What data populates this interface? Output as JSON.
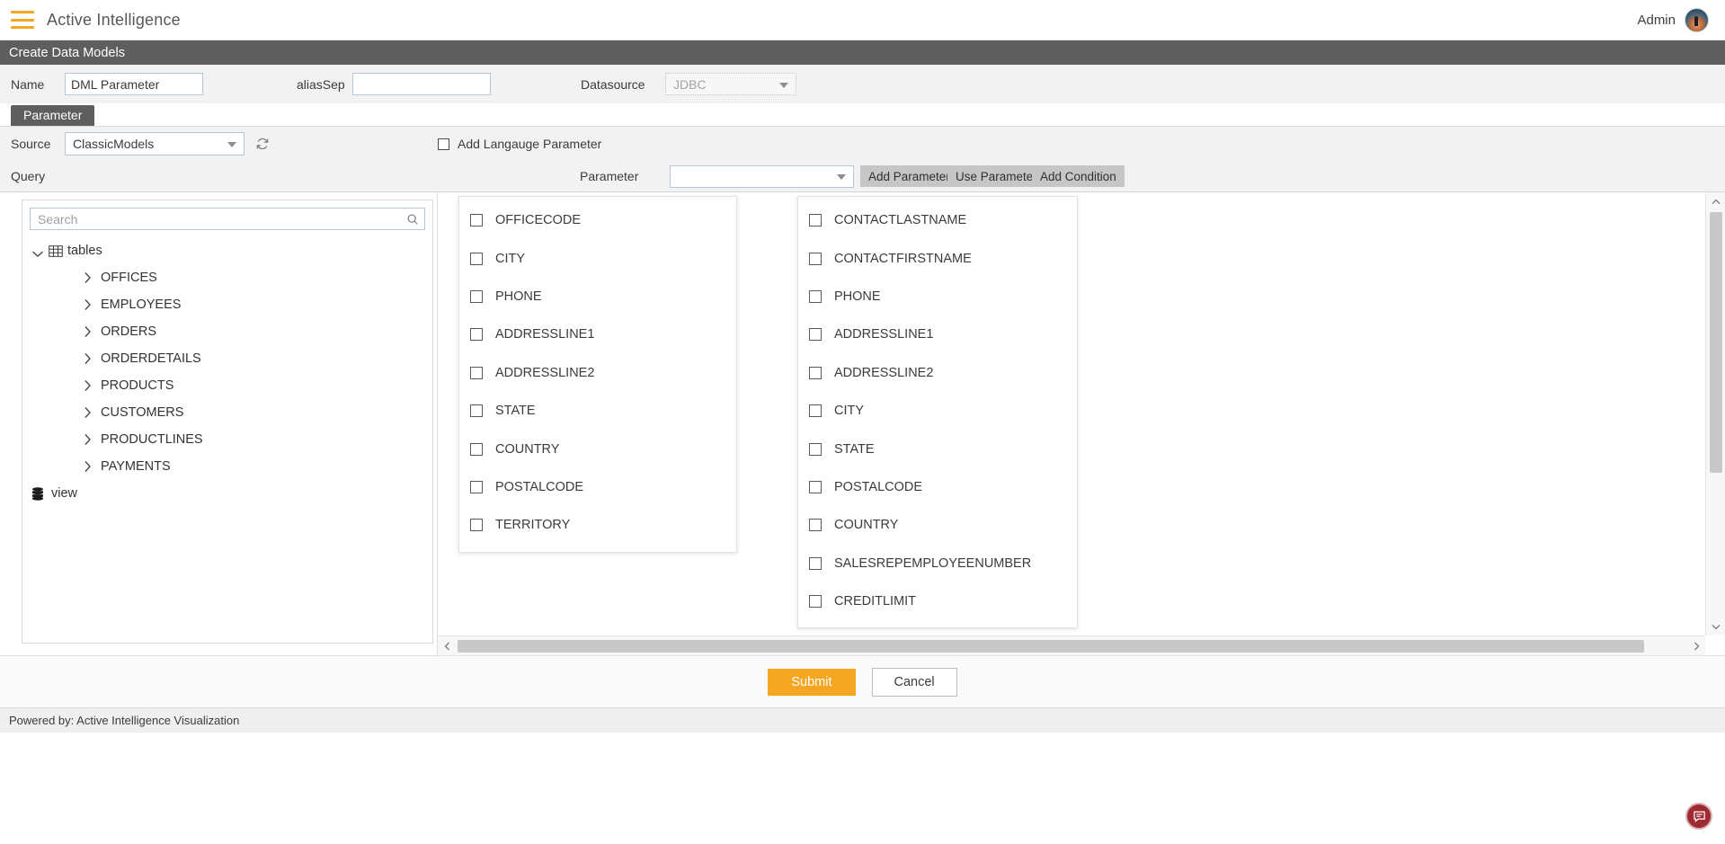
{
  "topbar": {
    "menu_icon": "hamburger-menu-icon",
    "app_title": "Active Intelligence",
    "admin_label": "Admin",
    "avatar_icon": "user-avatar"
  },
  "page": {
    "title": "Create Data Models"
  },
  "form": {
    "name_label": "Name",
    "name_value": "DML Parameter",
    "alias_label": "aliasSep",
    "alias_value": "",
    "alias_placeholder": "",
    "datasource_label": "Datasource",
    "datasource_value": "JDBC"
  },
  "tabs": {
    "active": "Parameter"
  },
  "parameter_panel": {
    "source_label": "Source",
    "source_value": "ClassicModels",
    "refresh_icon": "refresh-icon",
    "language_checkbox_label": "Add Langauge Parameter",
    "language_checked": false,
    "query_label": "Query",
    "parameter_label": "Parameter",
    "parameter_value": "",
    "buttons": {
      "add_parameter": "Add Parameter",
      "use_parameter": "Use Parameter",
      "add_condition": "Add Condition"
    }
  },
  "tree": {
    "search_placeholder": "Search",
    "search_value": "",
    "search_icon": "search-icon",
    "root_label": "tables",
    "root_icon": "table-grid-icon",
    "root_expanded": true,
    "children": [
      {
        "label": "OFFICES"
      },
      {
        "label": "EMPLOYEES"
      },
      {
        "label": "ORDERS"
      },
      {
        "label": "ORDERDETAILS"
      },
      {
        "label": "PRODUCTS"
      },
      {
        "label": "CUSTOMERS"
      },
      {
        "label": "PRODUCTLINES"
      },
      {
        "label": "PAYMENTS"
      }
    ],
    "view_label": "view",
    "view_icon": "database-icon"
  },
  "columns": [
    {
      "id": "column-offices",
      "fields": [
        {
          "label": "OFFICECODE",
          "checked": false
        },
        {
          "label": "CITY",
          "checked": false
        },
        {
          "label": "PHONE",
          "checked": false
        },
        {
          "label": "ADDRESSLINE1",
          "checked": false
        },
        {
          "label": "ADDRESSLINE2",
          "checked": false
        },
        {
          "label": "STATE",
          "checked": false
        },
        {
          "label": "COUNTRY",
          "checked": false
        },
        {
          "label": "POSTALCODE",
          "checked": false
        },
        {
          "label": "TERRITORY",
          "checked": false
        }
      ]
    },
    {
      "id": "column-customers",
      "fields": [
        {
          "label": "CONTACTLASTNAME",
          "checked": false
        },
        {
          "label": "CONTACTFIRSTNAME",
          "checked": false
        },
        {
          "label": "PHONE",
          "checked": false
        },
        {
          "label": "ADDRESSLINE1",
          "checked": false
        },
        {
          "label": "ADDRESSLINE2",
          "checked": false
        },
        {
          "label": "CITY",
          "checked": false
        },
        {
          "label": "STATE",
          "checked": false
        },
        {
          "label": "POSTALCODE",
          "checked": false
        },
        {
          "label": "COUNTRY",
          "checked": false
        },
        {
          "label": "SALESREPEMPLOYEENUMBER",
          "checked": false
        },
        {
          "label": "CREDITLIMIT",
          "checked": false
        }
      ]
    }
  ],
  "actions": {
    "submit_label": "Submit",
    "cancel_label": "Cancel"
  },
  "status": {
    "powered_by": "Powered by: Active Intelligence Visualization",
    "chat_icon": "chat-bubble-icon"
  },
  "colors": {
    "accent": "#F5A623",
    "title_bar": "#5e5e5e",
    "chat_fab": "#9E2B31"
  }
}
